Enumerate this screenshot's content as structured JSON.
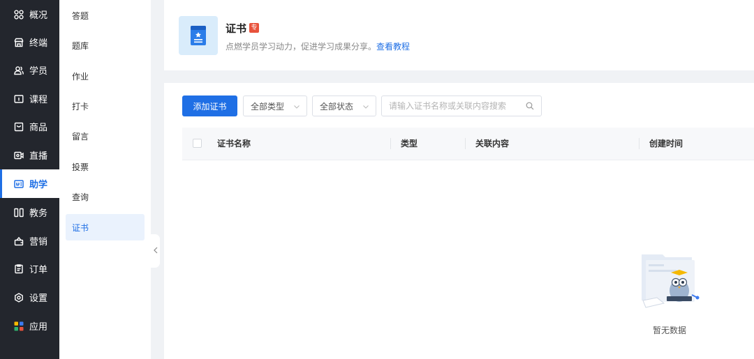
{
  "nav_primary": [
    {
      "label": "概况",
      "icon": "grid-icon"
    },
    {
      "label": "终端",
      "icon": "store-icon"
    },
    {
      "label": "学员",
      "icon": "users-icon"
    },
    {
      "label": "课程",
      "icon": "course-icon"
    },
    {
      "label": "商品",
      "icon": "goods-icon"
    },
    {
      "label": "直播",
      "icon": "live-icon"
    },
    {
      "label": "助学",
      "icon": "assist-icon",
      "active": true
    },
    {
      "label": "教务",
      "icon": "academic-icon"
    },
    {
      "label": "营销",
      "icon": "marketing-icon"
    },
    {
      "label": "订单",
      "icon": "order-icon"
    },
    {
      "label": "设置",
      "icon": "settings-icon"
    },
    {
      "label": "应用",
      "icon": "apps-icon"
    }
  ],
  "nav_secondary": [
    {
      "label": "答题"
    },
    {
      "label": "题库"
    },
    {
      "label": "作业"
    },
    {
      "label": "打卡"
    },
    {
      "label": "留言"
    },
    {
      "label": "投票"
    },
    {
      "label": "查询"
    },
    {
      "label": "证书",
      "active": true
    }
  ],
  "header": {
    "title": "证书",
    "tag": "专",
    "description": "点燃学员学习动力，促进学习成果分享。",
    "tutorial_link": "查看教程"
  },
  "toolbar": {
    "add_button": "添加证书",
    "type_filter": "全部类型",
    "status_filter": "全部状态",
    "search_placeholder": "请输入证书名称或关联内容搜索"
  },
  "table": {
    "columns": [
      "证书名称",
      "类型",
      "关联内容",
      "创建时间"
    ],
    "rows": []
  },
  "empty_state": {
    "text": "暂无数据"
  },
  "colors": {
    "accent": "#1f6fe5",
    "sidebar_bg": "#23262d",
    "tag_red": "#e8533c"
  }
}
